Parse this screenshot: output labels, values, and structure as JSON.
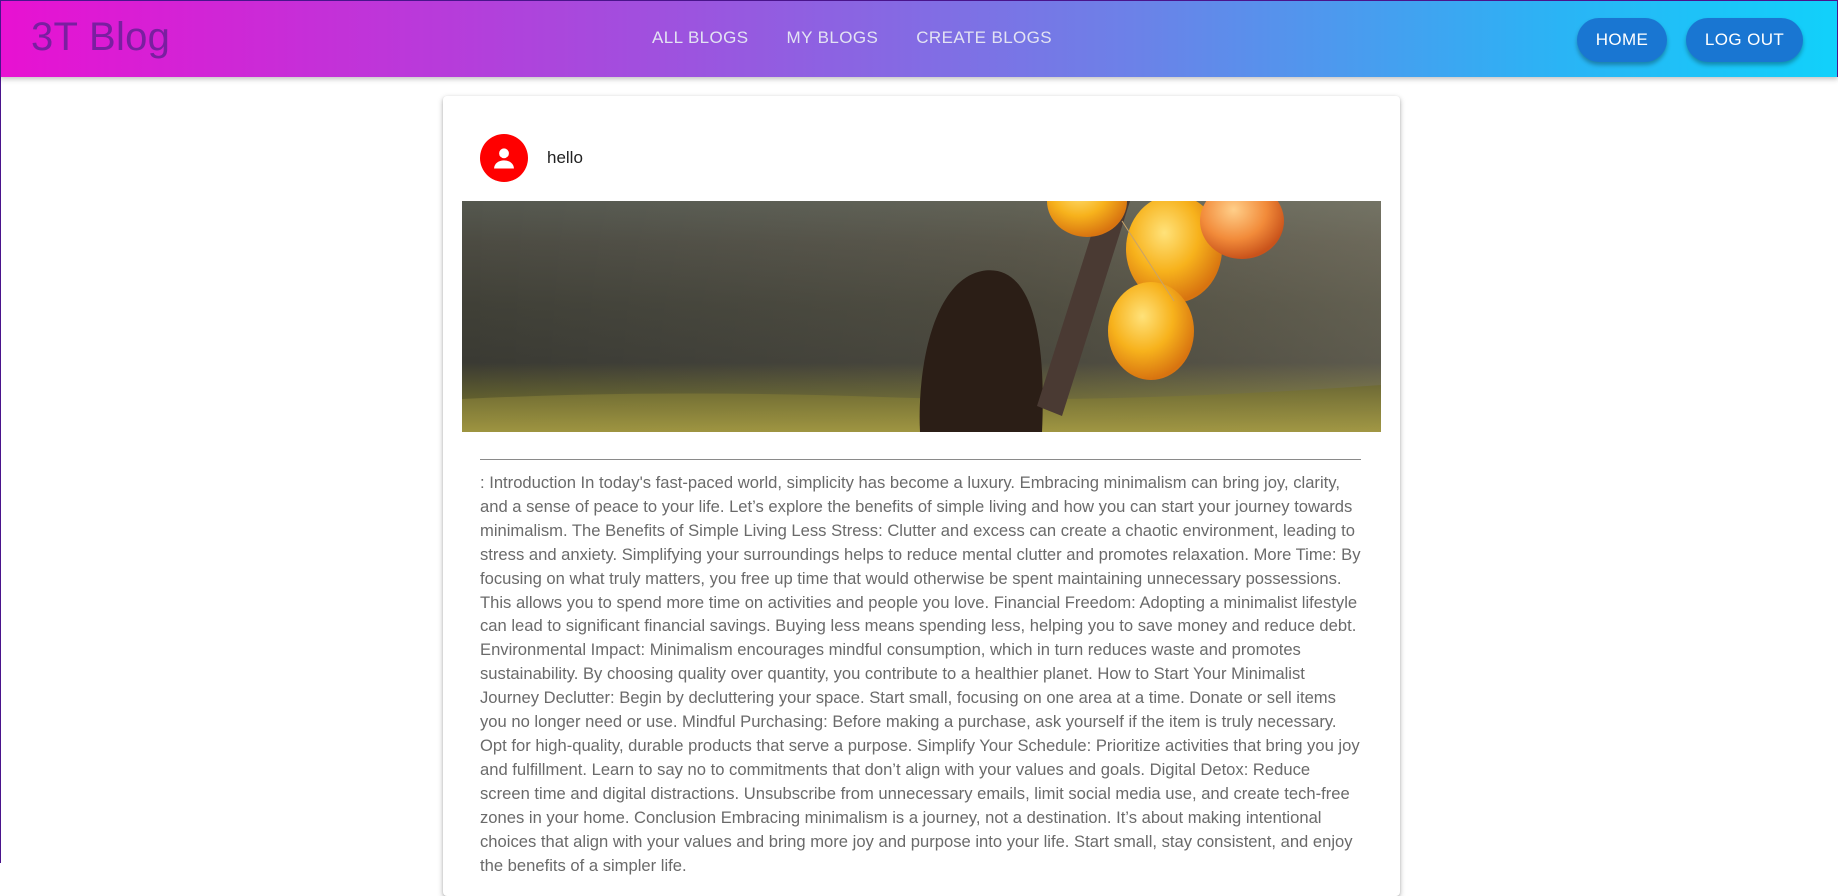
{
  "header": {
    "brand": "3T Blog",
    "nav": [
      "ALL BLOGS",
      "MY BLOGS",
      "CREATE BLOGS"
    ],
    "home_label": "HOME",
    "logout_label": "LOG OUT"
  },
  "post": {
    "author": "hello",
    "avatar_icon": "person-icon",
    "cover_alt": "girl-with-balloons",
    "content": ": Introduction In today's fast-paced world, simplicity has become a luxury. Embracing minimalism can bring joy, clarity, and a sense of peace to your life. Let’s explore the benefits of simple living and how you can start your journey towards minimalism. The Benefits of Simple Living Less Stress: Clutter and excess can create a chaotic environment, leading to stress and anxiety. Simplifying your surroundings helps to reduce mental clutter and promotes relaxation. More Time: By focusing on what truly matters, you free up time that would otherwise be spent maintaining unnecessary possessions. This allows you to spend more time on activities and people you love. Financial Freedom: Adopting a minimalist lifestyle can lead to significant financial savings. Buying less means spending less, helping you to save money and reduce debt. Environmental Impact: Minimalism encourages mindful consumption, which in turn reduces waste and promotes sustainability. By choosing quality over quantity, you contribute to a healthier planet. How to Start Your Minimalist Journey Declutter: Begin by decluttering your space. Start small, focusing on one area at a time. Donate or sell items you no longer need or use. Mindful Purchasing: Before making a purchase, ask yourself if the item is truly necessary. Opt for high-quality, durable products that serve a purpose. Simplify Your Schedule: Prioritize activities that bring you joy and fulfillment. Learn to say no to commitments that don’t align with your values and goals. Digital Detox: Reduce screen time and digital distractions. Unsubscribe from unnecessary emails, limit social media use, and create tech-free zones in your home. Conclusion Embracing minimalism is a journey, not a destination. It’s about making intentional choices that align with your values and bring more joy and purpose into your life. Start small, stay consistent, and enjoy the benefits of a simpler life."
  },
  "colors": {
    "accent_button": "#1976d2",
    "avatar": "#ff0000",
    "brand_text": "#7a1fa0"
  }
}
